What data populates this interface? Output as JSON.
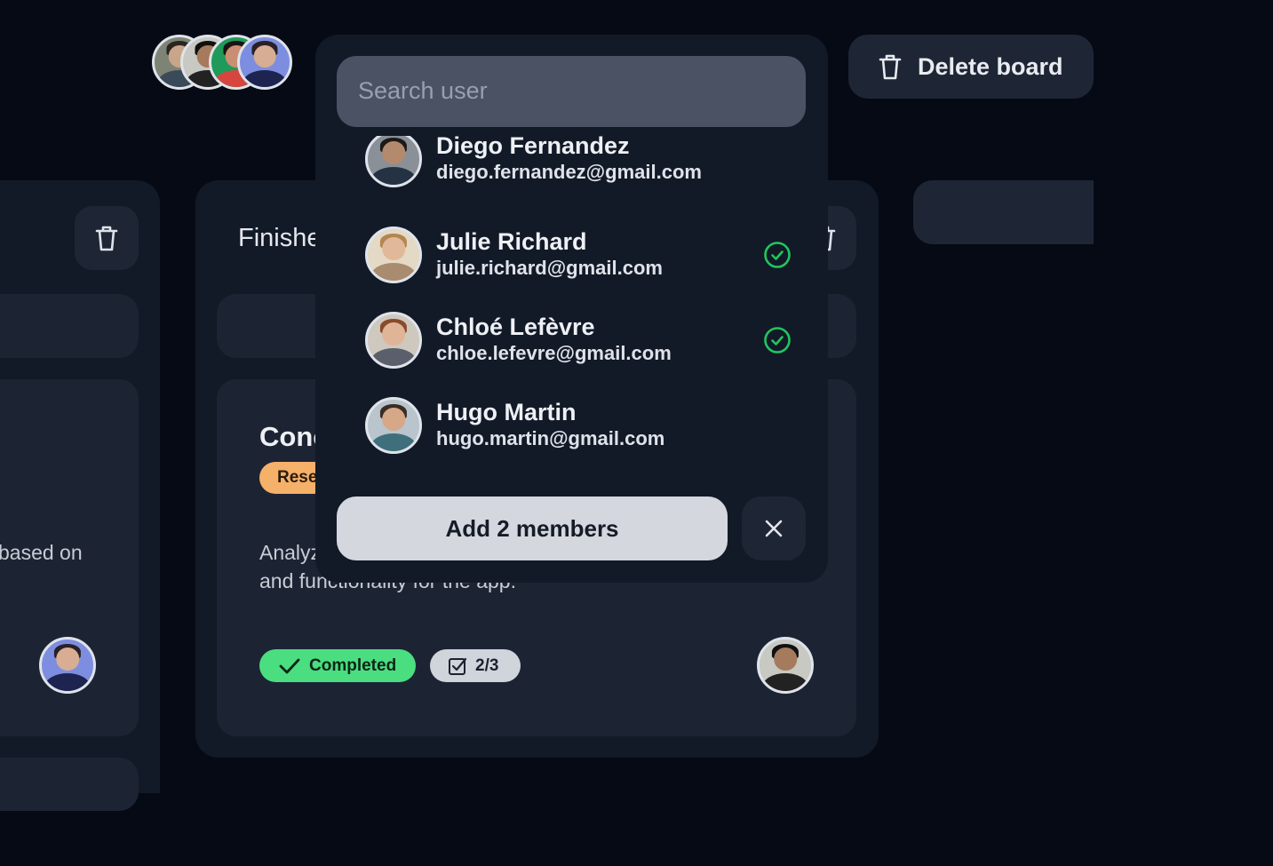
{
  "header": {
    "delete_board_label": "Delete board"
  },
  "left_column": {
    "card_text": "based on"
  },
  "finished_column": {
    "title": "Finished",
    "card": {
      "title": "Conc",
      "tag": "Research",
      "description_line1": "Analyz",
      "description_line2": "and functionality for the app.",
      "status": "Completed",
      "checklist": "2/3"
    }
  },
  "member_picker": {
    "search_placeholder": "Search user",
    "users": [
      {
        "name": "Diego Fernandez",
        "email": "diego.fernandez@gmail.com",
        "selected": false
      },
      {
        "name": "Julie Richard",
        "email": "julie.richard@gmail.com",
        "selected": true
      },
      {
        "name": "Chloé Lefèvre",
        "email": "chloe.lefevre@gmail.com",
        "selected": true
      },
      {
        "name": "Hugo Martin",
        "email": "hugo.martin@gmail.com",
        "selected": false
      }
    ],
    "add_button_label": "Add 2 members"
  },
  "colors": {
    "background": "#060a15",
    "panel": "#121a28",
    "card": "#1c2434",
    "selected_check": "#22c55e",
    "completed": "#4ade80",
    "research_tag": "#f5b06a"
  }
}
